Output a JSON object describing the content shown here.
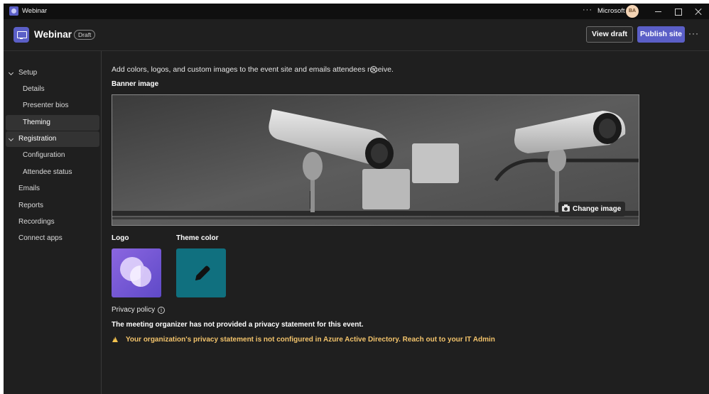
{
  "window": {
    "title": "Webinar",
    "organization": "Microsoft",
    "avatar_initials": "BA"
  },
  "header": {
    "title": "Webinar",
    "badge": "Draft",
    "view_draft_label": "View draft",
    "publish_label": "Publish site"
  },
  "sidebar": {
    "items": [
      {
        "label": "Setup",
        "expandable": true,
        "selected": false
      },
      {
        "label": "Details",
        "expandable": false,
        "selected": false
      },
      {
        "label": "Presenter bios",
        "expandable": false,
        "selected": false
      },
      {
        "label": "Theming",
        "expandable": false,
        "selected": true
      },
      {
        "label": "Registration",
        "expandable": true,
        "selected": true
      },
      {
        "label": "Configuration",
        "expandable": false,
        "selected": false
      },
      {
        "label": "Attendee status",
        "expandable": false,
        "selected": false
      },
      {
        "label": "Emails",
        "expandable": false,
        "selected": false
      },
      {
        "label": "Reports",
        "expandable": false,
        "selected": false
      },
      {
        "label": "Recordings",
        "expandable": false,
        "selected": false
      },
      {
        "label": "Connect apps",
        "expandable": false,
        "selected": false
      }
    ]
  },
  "main": {
    "intro": "Add colors, logos, and custom images to the event site and emails attendees receive.",
    "banner_label": "Banner image",
    "change_image_label": "Change image",
    "logo_label": "Logo",
    "theme_color_label": "Theme color",
    "theme_color": "#10707f",
    "privacy_label": "Privacy policy",
    "privacy_message": "The meeting organizer has not provided a privacy statement for this event.",
    "warning_message": "Your organization's privacy statement is not configured in Azure Active Directory. Reach out to your IT Admin"
  },
  "colors": {
    "accent": "#5b5fc7",
    "warning": "#f2c36b",
    "background": "#1f1f1f"
  }
}
